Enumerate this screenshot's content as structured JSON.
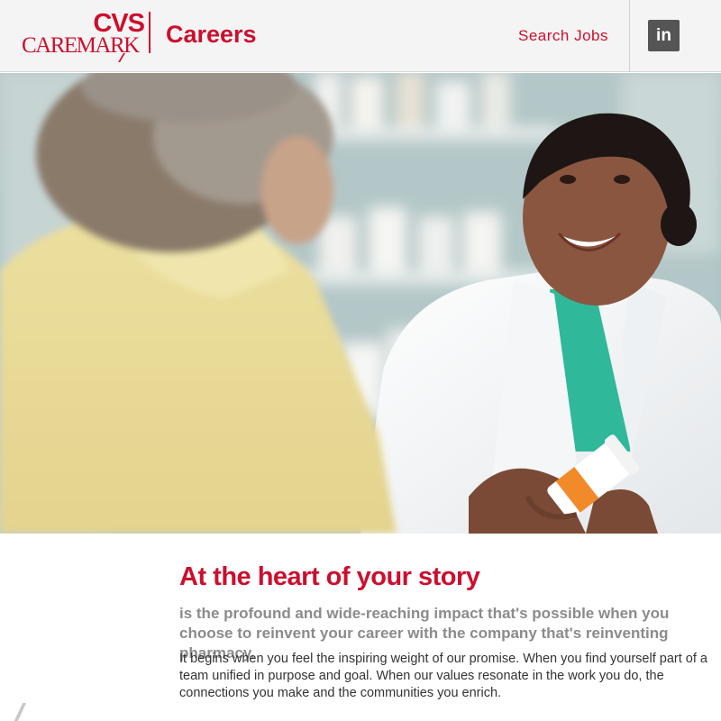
{
  "header": {
    "logo": {
      "top_line": "CVS",
      "bottom_line": "CAREMARK",
      "icon": "cvs-caremark-logo"
    },
    "title": "Careers",
    "nav": {
      "search_jobs": "Search Jobs"
    },
    "social": {
      "linkedin_label": "in",
      "icon": "linkedin-icon"
    }
  },
  "hero": {
    "image": "pharmacist-smiling-holding-prescription-bottle"
  },
  "content": {
    "heading": "At the heart of your story",
    "intro": "is the profound and wide-reaching impact that's possible when you choose to reinvent your career with the company that's reinventing pharmacy.",
    "body": "It begins when you feel the inspiring weight of our promise. When you find yourself part of a team unified in purpose and goal. When our values resonate in the work you do, the connections you make and the communities you enrich."
  },
  "colors": {
    "brand_red": "#cc0f2e",
    "header_bg": "#f4f4f4",
    "intro_gray": "#8b8b8b",
    "body_text": "#333333",
    "linkedin_bg": "#555555"
  }
}
